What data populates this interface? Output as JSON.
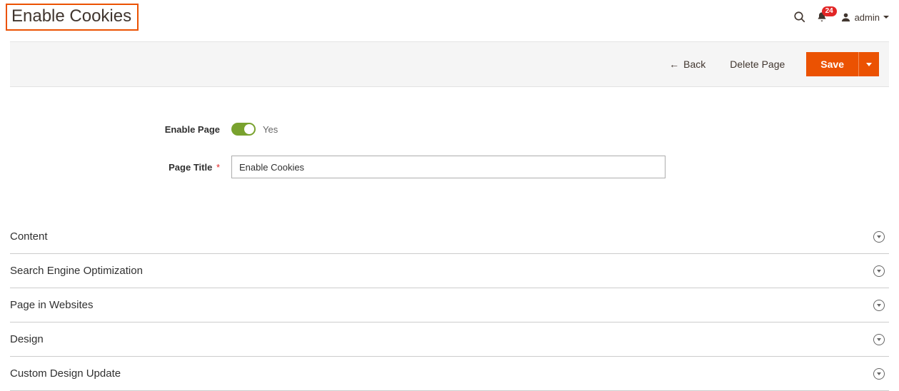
{
  "header": {
    "title": "Enable Cookies",
    "notifications_count": "24",
    "user_name": "admin"
  },
  "actions": {
    "back_label": "Back",
    "delete_label": "Delete Page",
    "save_label": "Save"
  },
  "form": {
    "enable_page_label": "Enable Page",
    "enable_page_value": "Yes",
    "page_title_label": "Page Title",
    "page_title_value": "Enable Cookies"
  },
  "sections": [
    {
      "title": "Content"
    },
    {
      "title": "Search Engine Optimization"
    },
    {
      "title": "Page in Websites"
    },
    {
      "title": "Design"
    },
    {
      "title": "Custom Design Update"
    }
  ]
}
